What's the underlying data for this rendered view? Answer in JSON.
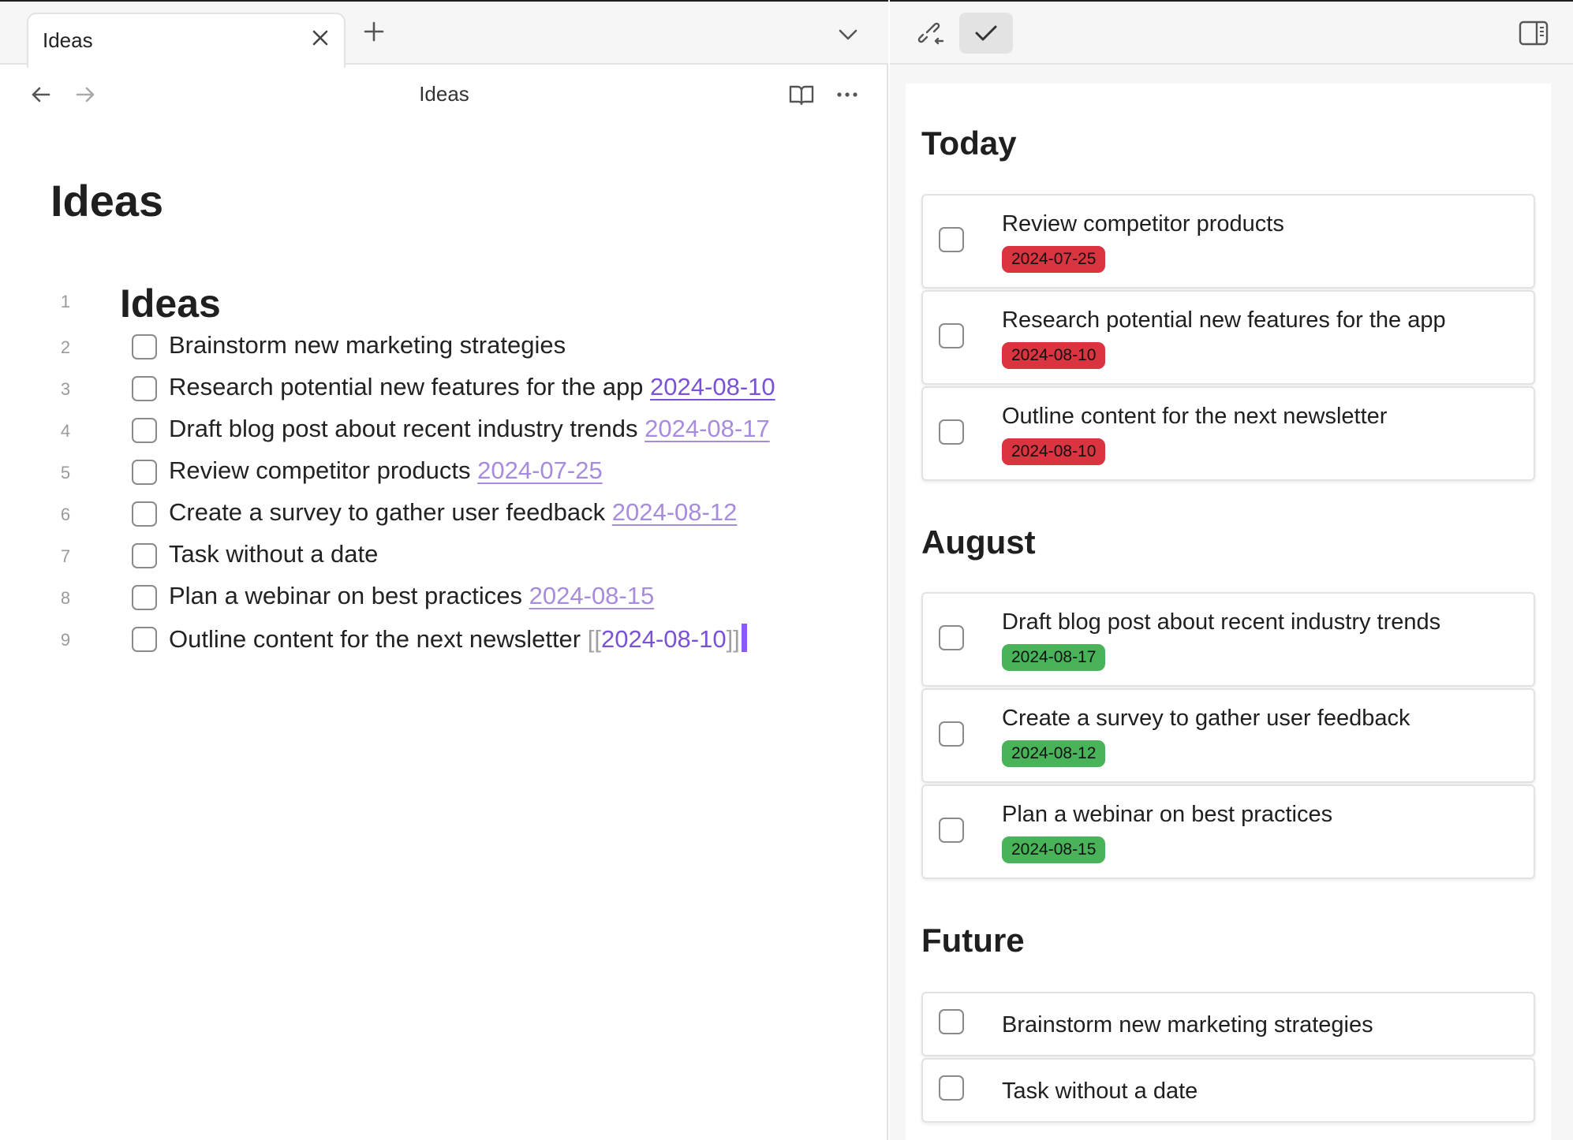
{
  "colors": {
    "accent_purple": "#7a52d6",
    "date_link_purple": "#a78bdc",
    "overdue_red": "#d9343f",
    "upcoming_green": "#49b35a",
    "cursor_purple": "#8a5cf6"
  },
  "tab_bar": {
    "active_tab": {
      "title": "Ideas",
      "close_icon": "close-icon"
    },
    "new_tab_icon": "plus-icon",
    "tab_list_icon": "chevron-down-icon"
  },
  "nav": {
    "back_icon": "arrow-left-icon",
    "forward_icon": "arrow-right-icon",
    "title": "Ideas",
    "reading_view_icon": "book-open-icon",
    "more_icon": "more-horizontal-icon"
  },
  "note": {
    "inline_title": "Ideas",
    "heading": {
      "line_number": "1",
      "text": "Ideas"
    },
    "lines": [
      {
        "line_number": "2",
        "text": "Brainstorm new marketing strategies",
        "date": ""
      },
      {
        "line_number": "3",
        "text": "Research potential new features for the app ",
        "date": "2024-08-10"
      },
      {
        "line_number": "4",
        "text": "Draft blog post about recent industry trends ",
        "date": "2024-08-17"
      },
      {
        "line_number": "5",
        "text": "Review competitor products ",
        "date": "2024-07-25"
      },
      {
        "line_number": "6",
        "text": "Create a survey to gather user feedback ",
        "date": "2024-08-12"
      },
      {
        "line_number": "7",
        "text": "Task without a date",
        "date": ""
      },
      {
        "line_number": "8",
        "text": "Plan a webinar on best practices ",
        "date": "2024-08-15"
      },
      {
        "line_number": "9",
        "text": "Outline content for the next newsletter ",
        "bracket_open": "[[",
        "date": "2024-08-10",
        "bracket_close": "]]"
      }
    ]
  },
  "right_toolbar": {
    "backlinks_icon": "link-backlinks-icon",
    "tasks_icon": "checkmark-icon",
    "sidebar_toggle_icon": "sidebar-right-icon"
  },
  "task_view": {
    "sections": [
      {
        "heading": "Today",
        "tasks": [
          {
            "text": "Review competitor products",
            "due": "2024-07-25",
            "status": "overdue"
          },
          {
            "text": "Research potential new features for the app",
            "due": "2024-08-10",
            "status": "overdue"
          },
          {
            "text": "Outline content for the next newsletter",
            "due": "2024-08-10",
            "status": "overdue"
          }
        ]
      },
      {
        "heading": "August",
        "tasks": [
          {
            "text": "Draft blog post about recent industry trends",
            "due": "2024-08-17",
            "status": "upcoming"
          },
          {
            "text": "Create a survey to gather user feedback",
            "due": "2024-08-12",
            "status": "upcoming"
          },
          {
            "text": "Plan a webinar on best practices",
            "due": "2024-08-15",
            "status": "upcoming"
          }
        ]
      },
      {
        "heading": "Future",
        "tasks": [
          {
            "text": "Brainstorm new marketing strategies",
            "due": "",
            "status": "none"
          },
          {
            "text": "Task without a date",
            "due": "",
            "status": "none"
          }
        ]
      }
    ]
  }
}
